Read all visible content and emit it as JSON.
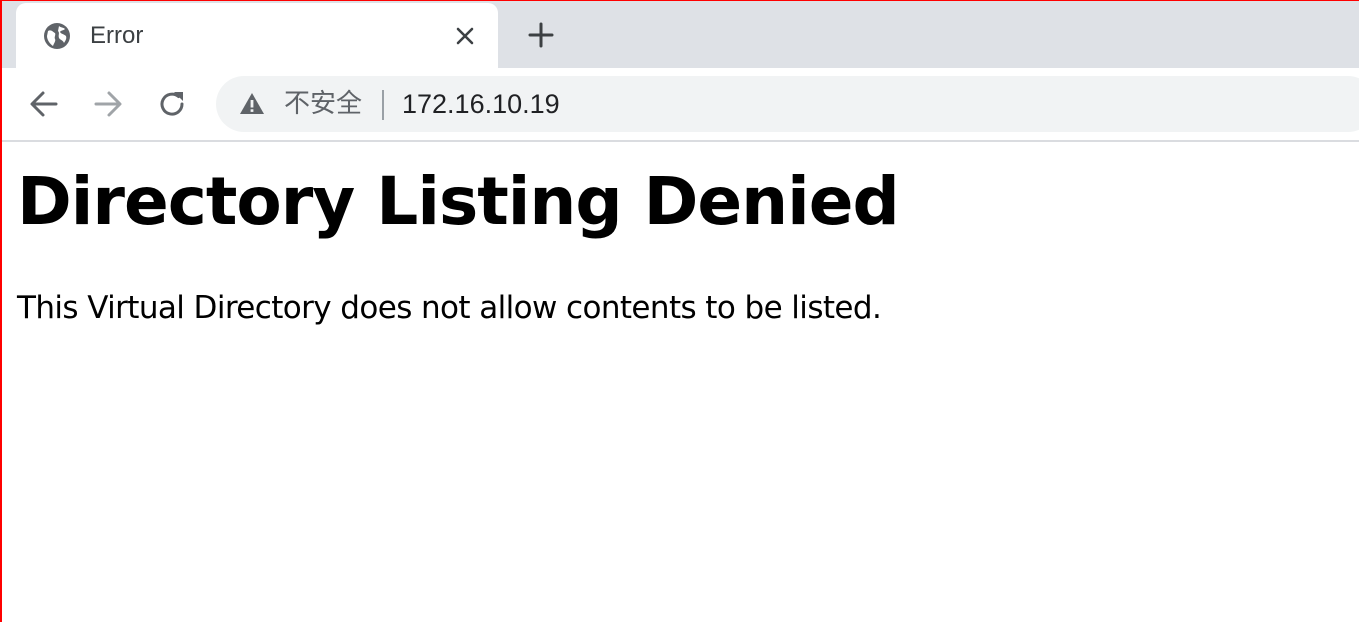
{
  "browser": {
    "tab": {
      "title": "Error",
      "icon": "globe-icon",
      "close_icon": "close-icon"
    },
    "new_tab_icon": "plus-icon",
    "nav": {
      "back_icon": "arrow-left-icon",
      "forward_icon": "arrow-right-icon",
      "reload_icon": "reload-icon"
    },
    "omnibox": {
      "security_icon": "warning-triangle-icon",
      "security_label": "不安全",
      "url": "172.16.10.19"
    }
  },
  "page": {
    "heading": "Directory Listing Denied",
    "message": "This Virtual Directory does not allow contents to be listed."
  },
  "colors": {
    "tabstrip_bg": "#dee1e6",
    "omnibox_bg": "#f1f3f4",
    "icon_gray": "#5f6368",
    "icon_disabled": "#a0a4a8",
    "frame_border": "#ff0000"
  }
}
